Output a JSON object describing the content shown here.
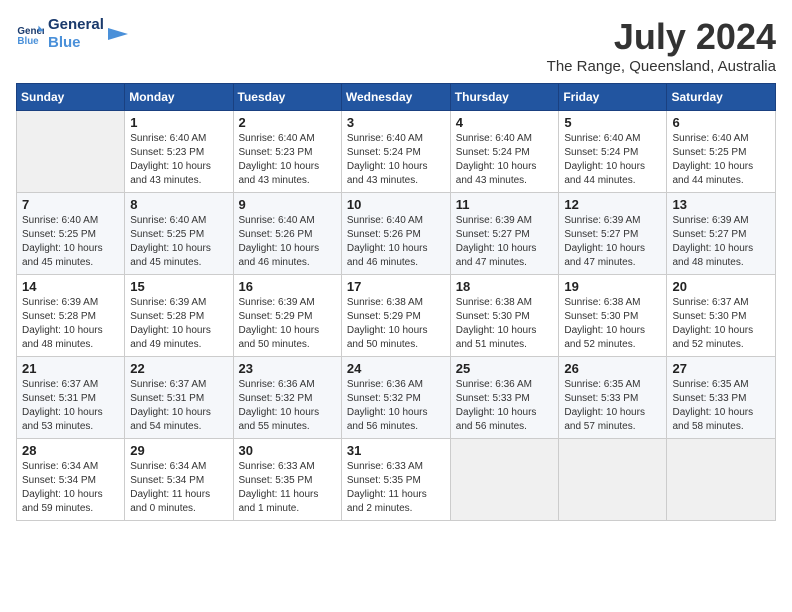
{
  "logo": {
    "text_general": "General",
    "text_blue": "Blue"
  },
  "title": {
    "month_year": "July 2024",
    "location": "The Range, Queensland, Australia"
  },
  "days_of_week": [
    "Sunday",
    "Monday",
    "Tuesday",
    "Wednesday",
    "Thursday",
    "Friday",
    "Saturday"
  ],
  "weeks": [
    [
      {
        "day": "",
        "sunrise": "",
        "sunset": "",
        "daylight": ""
      },
      {
        "day": "1",
        "sunrise": "Sunrise: 6:40 AM",
        "sunset": "Sunset: 5:23 PM",
        "daylight": "Daylight: 10 hours and 43 minutes."
      },
      {
        "day": "2",
        "sunrise": "Sunrise: 6:40 AM",
        "sunset": "Sunset: 5:23 PM",
        "daylight": "Daylight: 10 hours and 43 minutes."
      },
      {
        "day": "3",
        "sunrise": "Sunrise: 6:40 AM",
        "sunset": "Sunset: 5:24 PM",
        "daylight": "Daylight: 10 hours and 43 minutes."
      },
      {
        "day": "4",
        "sunrise": "Sunrise: 6:40 AM",
        "sunset": "Sunset: 5:24 PM",
        "daylight": "Daylight: 10 hours and 43 minutes."
      },
      {
        "day": "5",
        "sunrise": "Sunrise: 6:40 AM",
        "sunset": "Sunset: 5:24 PM",
        "daylight": "Daylight: 10 hours and 44 minutes."
      },
      {
        "day": "6",
        "sunrise": "Sunrise: 6:40 AM",
        "sunset": "Sunset: 5:25 PM",
        "daylight": "Daylight: 10 hours and 44 minutes."
      }
    ],
    [
      {
        "day": "7",
        "sunrise": "Sunrise: 6:40 AM",
        "sunset": "Sunset: 5:25 PM",
        "daylight": "Daylight: 10 hours and 45 minutes."
      },
      {
        "day": "8",
        "sunrise": "Sunrise: 6:40 AM",
        "sunset": "Sunset: 5:25 PM",
        "daylight": "Daylight: 10 hours and 45 minutes."
      },
      {
        "day": "9",
        "sunrise": "Sunrise: 6:40 AM",
        "sunset": "Sunset: 5:26 PM",
        "daylight": "Daylight: 10 hours and 46 minutes."
      },
      {
        "day": "10",
        "sunrise": "Sunrise: 6:40 AM",
        "sunset": "Sunset: 5:26 PM",
        "daylight": "Daylight: 10 hours and 46 minutes."
      },
      {
        "day": "11",
        "sunrise": "Sunrise: 6:39 AM",
        "sunset": "Sunset: 5:27 PM",
        "daylight": "Daylight: 10 hours and 47 minutes."
      },
      {
        "day": "12",
        "sunrise": "Sunrise: 6:39 AM",
        "sunset": "Sunset: 5:27 PM",
        "daylight": "Daylight: 10 hours and 47 minutes."
      },
      {
        "day": "13",
        "sunrise": "Sunrise: 6:39 AM",
        "sunset": "Sunset: 5:27 PM",
        "daylight": "Daylight: 10 hours and 48 minutes."
      }
    ],
    [
      {
        "day": "14",
        "sunrise": "Sunrise: 6:39 AM",
        "sunset": "Sunset: 5:28 PM",
        "daylight": "Daylight: 10 hours and 48 minutes."
      },
      {
        "day": "15",
        "sunrise": "Sunrise: 6:39 AM",
        "sunset": "Sunset: 5:28 PM",
        "daylight": "Daylight: 10 hours and 49 minutes."
      },
      {
        "day": "16",
        "sunrise": "Sunrise: 6:39 AM",
        "sunset": "Sunset: 5:29 PM",
        "daylight": "Daylight: 10 hours and 50 minutes."
      },
      {
        "day": "17",
        "sunrise": "Sunrise: 6:38 AM",
        "sunset": "Sunset: 5:29 PM",
        "daylight": "Daylight: 10 hours and 50 minutes."
      },
      {
        "day": "18",
        "sunrise": "Sunrise: 6:38 AM",
        "sunset": "Sunset: 5:30 PM",
        "daylight": "Daylight: 10 hours and 51 minutes."
      },
      {
        "day": "19",
        "sunrise": "Sunrise: 6:38 AM",
        "sunset": "Sunset: 5:30 PM",
        "daylight": "Daylight: 10 hours and 52 minutes."
      },
      {
        "day": "20",
        "sunrise": "Sunrise: 6:37 AM",
        "sunset": "Sunset: 5:30 PM",
        "daylight": "Daylight: 10 hours and 52 minutes."
      }
    ],
    [
      {
        "day": "21",
        "sunrise": "Sunrise: 6:37 AM",
        "sunset": "Sunset: 5:31 PM",
        "daylight": "Daylight: 10 hours and 53 minutes."
      },
      {
        "day": "22",
        "sunrise": "Sunrise: 6:37 AM",
        "sunset": "Sunset: 5:31 PM",
        "daylight": "Daylight: 10 hours and 54 minutes."
      },
      {
        "day": "23",
        "sunrise": "Sunrise: 6:36 AM",
        "sunset": "Sunset: 5:32 PM",
        "daylight": "Daylight: 10 hours and 55 minutes."
      },
      {
        "day": "24",
        "sunrise": "Sunrise: 6:36 AM",
        "sunset": "Sunset: 5:32 PM",
        "daylight": "Daylight: 10 hours and 56 minutes."
      },
      {
        "day": "25",
        "sunrise": "Sunrise: 6:36 AM",
        "sunset": "Sunset: 5:33 PM",
        "daylight": "Daylight: 10 hours and 56 minutes."
      },
      {
        "day": "26",
        "sunrise": "Sunrise: 6:35 AM",
        "sunset": "Sunset: 5:33 PM",
        "daylight": "Daylight: 10 hours and 57 minutes."
      },
      {
        "day": "27",
        "sunrise": "Sunrise: 6:35 AM",
        "sunset": "Sunset: 5:33 PM",
        "daylight": "Daylight: 10 hours and 58 minutes."
      }
    ],
    [
      {
        "day": "28",
        "sunrise": "Sunrise: 6:34 AM",
        "sunset": "Sunset: 5:34 PM",
        "daylight": "Daylight: 10 hours and 59 minutes."
      },
      {
        "day": "29",
        "sunrise": "Sunrise: 6:34 AM",
        "sunset": "Sunset: 5:34 PM",
        "daylight": "Daylight: 11 hours and 0 minutes."
      },
      {
        "day": "30",
        "sunrise": "Sunrise: 6:33 AM",
        "sunset": "Sunset: 5:35 PM",
        "daylight": "Daylight: 11 hours and 1 minute."
      },
      {
        "day": "31",
        "sunrise": "Sunrise: 6:33 AM",
        "sunset": "Sunset: 5:35 PM",
        "daylight": "Daylight: 11 hours and 2 minutes."
      },
      {
        "day": "",
        "sunrise": "",
        "sunset": "",
        "daylight": ""
      },
      {
        "day": "",
        "sunrise": "",
        "sunset": "",
        "daylight": ""
      },
      {
        "day": "",
        "sunrise": "",
        "sunset": "",
        "daylight": ""
      }
    ]
  ]
}
